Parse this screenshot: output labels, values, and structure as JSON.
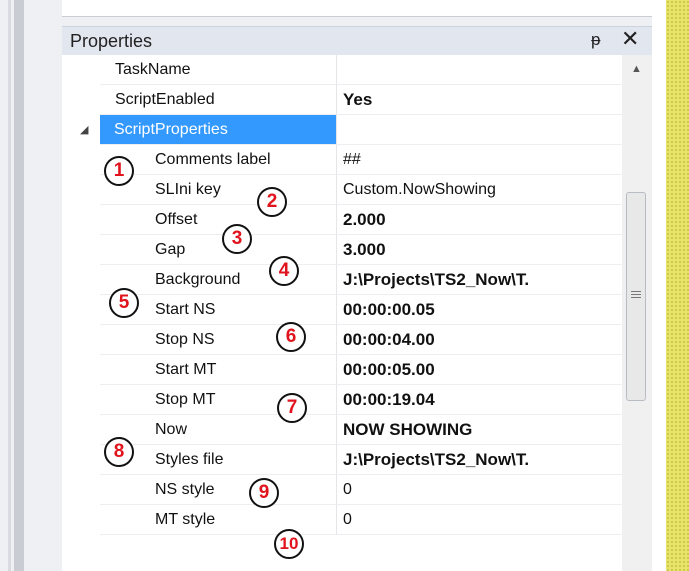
{
  "panel": {
    "title": "Properties",
    "pin_glyph": "ᵽ",
    "close_glyph": "✕"
  },
  "rows": [
    {
      "name": "TaskName",
      "value": ""
    },
    {
      "name": "ScriptEnabled",
      "value": "Yes"
    },
    {
      "name": "ScriptProperties",
      "value": "",
      "expander": "◢"
    },
    {
      "name": "Comments label",
      "value": "##"
    },
    {
      "name": "SLIni key",
      "value": "Custom.NowShowing"
    },
    {
      "name": "Offset",
      "value": "2.000"
    },
    {
      "name": "Gap",
      "value": "3.000"
    },
    {
      "name": "Background",
      "value": "J:\\Projects\\TS2_Now\\T."
    },
    {
      "name": "Start NS",
      "value": "00:00:00.05"
    },
    {
      "name": "Stop NS",
      "value": "00:00:04.00"
    },
    {
      "name": "Start MT",
      "value": "00:00:05.00"
    },
    {
      "name": "Stop MT",
      "value": "00:00:19.04"
    },
    {
      "name": "Now",
      "value": "NOW SHOWING"
    },
    {
      "name": "Styles file",
      "value": "J:\\Projects\\TS2_Now\\T."
    },
    {
      "name": "NS style",
      "value": "0"
    },
    {
      "name": "MT style",
      "value": "0"
    }
  ],
  "scrollbar": {
    "up_arrow": "▲"
  },
  "annotations": [
    "1",
    "2",
    "3",
    "4",
    "5",
    "6",
    "7",
    "8",
    "9",
    "10"
  ],
  "colors": {
    "selection": "#3399ff",
    "annotation_text": "#e1141e",
    "side_stripe": "#e8e36a"
  }
}
